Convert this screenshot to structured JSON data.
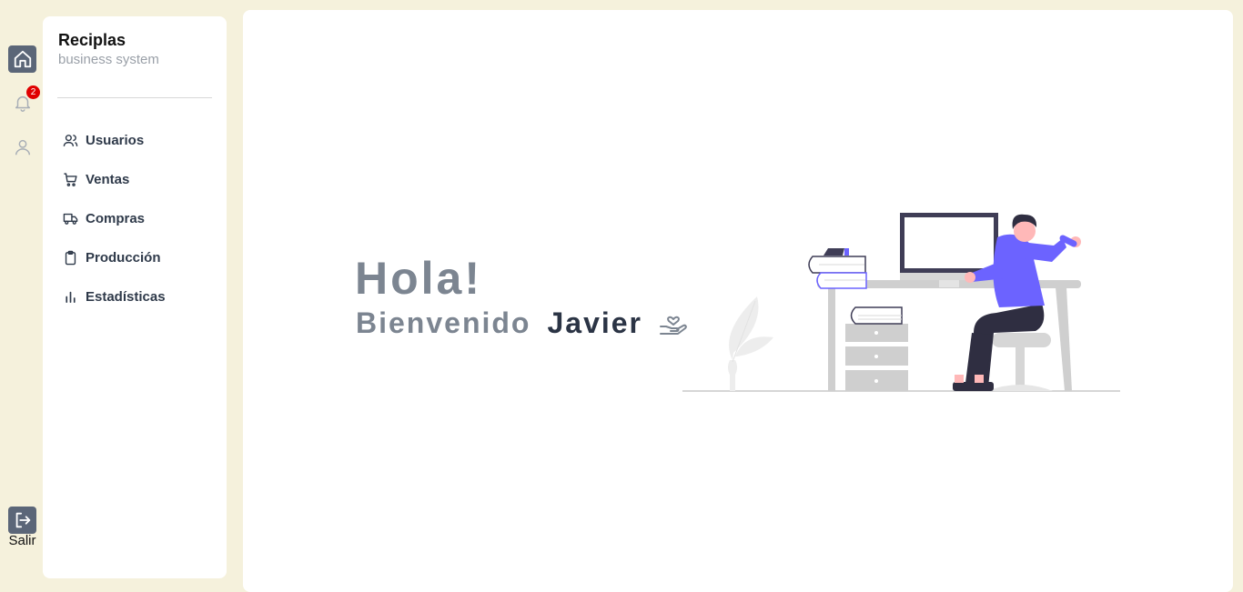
{
  "rail": {
    "notifications_count": "2",
    "logout_label": "Salir",
    "icons": [
      "home-icon",
      "bell-icon",
      "user-icon",
      "logout-icon"
    ]
  },
  "brand": {
    "title": "Reciplas",
    "subtitle": "business system"
  },
  "nav": {
    "items": [
      {
        "label": "Usuarios",
        "icon": "users-icon"
      },
      {
        "label": "Ventas",
        "icon": "cart-icon"
      },
      {
        "label": "Compras",
        "icon": "truck-icon"
      },
      {
        "label": "Producción",
        "icon": "clipboard-icon"
      },
      {
        "label": "Estadísticas",
        "icon": "bar-chart-icon"
      }
    ]
  },
  "main": {
    "greeting": "Hola!",
    "welcome": "Bienvenido",
    "user_name": "Javier"
  },
  "colors": {
    "background": "#f5f1dc",
    "panel": "#ffffff",
    "active_rail": "#5b6678",
    "badge": "#e00000",
    "text_muted": "#7c8591",
    "text_dark": "#2b3445",
    "accent": "#6c63ff"
  }
}
